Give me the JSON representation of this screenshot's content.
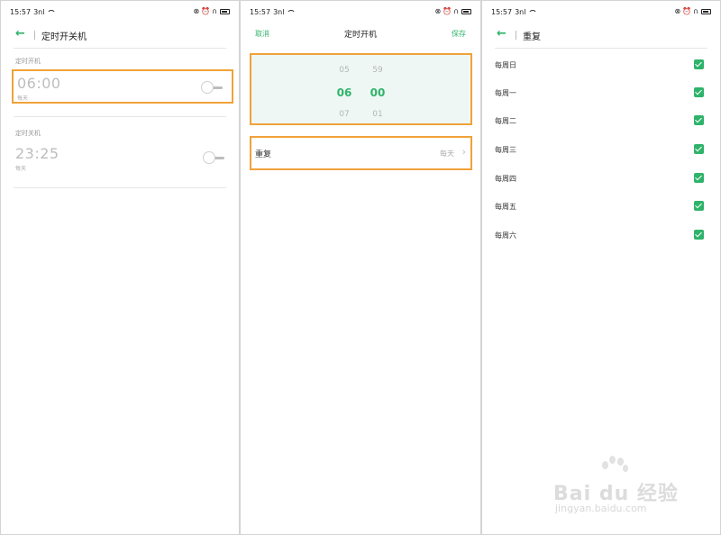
{
  "status_bar": {
    "time": "15:57",
    "signal": "3nl"
  },
  "screen1": {
    "title": "定时开关机",
    "on_section_label": "定时开机",
    "on_time": "06:00",
    "on_repeat": "每天",
    "off_section_label": "定时关机",
    "off_time": "23:25",
    "off_repeat": "每天"
  },
  "screen2": {
    "cancel_label": "取消",
    "title": "定时开机",
    "save_label": "保存",
    "hour_prev": "05",
    "hour_selected": "06",
    "hour_next": "07",
    "minute_prev": "59",
    "minute_selected": "00",
    "minute_next": "01",
    "repeat_label": "重复",
    "repeat_value": "每天"
  },
  "screen3": {
    "title": "重复",
    "days": [
      "每周日",
      "每周一",
      "每周二",
      "每周三",
      "每周四",
      "每周五",
      "每周六"
    ],
    "checked": [
      true,
      true,
      true,
      true,
      true,
      true,
      true
    ]
  },
  "watermark": {
    "logo": "Bai du 经验",
    "url": "jingyan.baidu.com"
  },
  "colors": {
    "accent": "#2fb36b",
    "highlight": "#f0a23a",
    "picker_bg": "#eef7f3"
  }
}
